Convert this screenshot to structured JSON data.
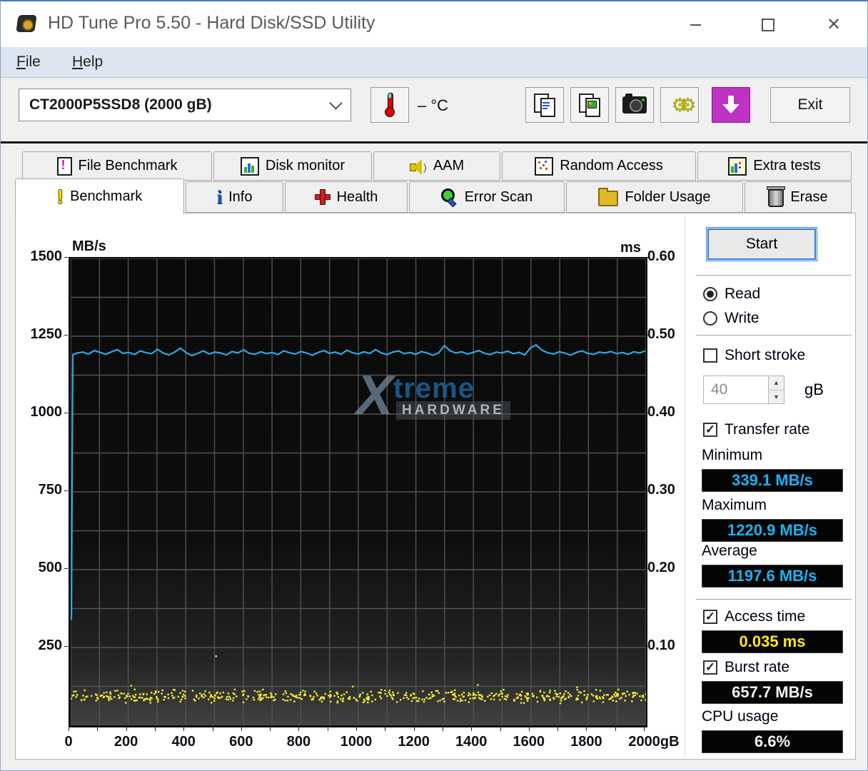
{
  "window": {
    "title": "HD Tune Pro 5.50 - Hard Disk/SSD Utility"
  },
  "menu": {
    "items": [
      {
        "accel": "F",
        "rest": "ile"
      },
      {
        "accel": "H",
        "rest": "elp"
      }
    ]
  },
  "toolbar": {
    "drive_select": "CT2000P5SSD8 (2000 gB)",
    "temperature": "– °C",
    "exit_label": "Exit",
    "icons": [
      "thermometer-icon",
      "copy-text-icon",
      "copy-image-icon",
      "camera-icon",
      "gears-icon",
      "save-arrow-icon"
    ]
  },
  "tabs": {
    "row1": [
      "File Benchmark",
      "Disk monitor",
      "AAM",
      "Random Access",
      "Extra tests"
    ],
    "row2": [
      "Benchmark",
      "Info",
      "Health",
      "Error Scan",
      "Folder Usage",
      "Erase"
    ],
    "active": "Benchmark"
  },
  "controls": {
    "start": "Start",
    "read": "Read",
    "write": "Write",
    "short_stroke": "Short stroke",
    "short_stroke_value": "40",
    "short_stroke_unit": "gB",
    "transfer_rate": "Transfer rate",
    "minimum": "Minimum",
    "maximum": "Maximum",
    "average": "Average",
    "access_time": "Access time",
    "burst_rate": "Burst rate",
    "cpu_usage": "CPU usage",
    "spin_up": "▲",
    "spin_down": "▼",
    "check_glyph": "✓",
    "values": {
      "minimum": "339.1 MB/s",
      "maximum": "1220.9 MB/s",
      "average": "1197.6 MB/s",
      "access_time": "0.035 ms",
      "burst_rate": "657.7 MB/s",
      "cpu_usage": "6.6%"
    }
  },
  "watermark": {
    "x": "X",
    "treme": "treme",
    "hardware": "HARDWARE"
  },
  "chart_data": {
    "type": "line",
    "title": "HD Tune benchmark transfer rate and access time",
    "x_axis": {
      "min": 0,
      "max": 2000,
      "grid_step": 100,
      "label_step": 200,
      "end_suffix": "gB"
    },
    "y_left": {
      "label": "MB/s",
      "min": 0,
      "max": 1500,
      "grid_step": 125,
      "label_step": 250
    },
    "y_right": {
      "label": "ms",
      "min": 0,
      "max": 0.6,
      "label_step": 0.1
    },
    "grid": true,
    "grid_color": "#525252",
    "series": [
      {
        "name": "transfer-rate",
        "unit": "MB/s",
        "color": "#2fa9dd",
        "style": "line",
        "points": [
          [
            0,
            339.1
          ],
          [
            5,
            1191
          ],
          [
            20,
            1196
          ],
          [
            40,
            1199
          ],
          [
            60,
            1193
          ],
          [
            80,
            1204
          ],
          [
            100,
            1198
          ],
          [
            120,
            1192
          ],
          [
            140,
            1200
          ],
          [
            160,
            1207
          ],
          [
            180,
            1195
          ],
          [
            200,
            1198
          ],
          [
            220,
            1191
          ],
          [
            240,
            1203
          ],
          [
            260,
            1197
          ],
          [
            280,
            1194
          ],
          [
            300,
            1208
          ],
          [
            320,
            1196
          ],
          [
            340,
            1190
          ],
          [
            360,
            1199
          ],
          [
            380,
            1212
          ],
          [
            400,
            1197
          ],
          [
            420,
            1188
          ],
          [
            440,
            1195
          ],
          [
            460,
            1203
          ],
          [
            480,
            1193
          ],
          [
            500,
            1199
          ],
          [
            520,
            1196
          ],
          [
            540,
            1190
          ],
          [
            560,
            1201
          ],
          [
            580,
            1196
          ],
          [
            600,
            1206
          ],
          [
            620,
            1195
          ],
          [
            640,
            1192
          ],
          [
            660,
            1200
          ],
          [
            680,
            1194
          ],
          [
            700,
            1198
          ],
          [
            720,
            1191
          ],
          [
            740,
            1203
          ],
          [
            760,
            1197
          ],
          [
            780,
            1193
          ],
          [
            800,
            1201
          ],
          [
            820,
            1196
          ],
          [
            840,
            1189
          ],
          [
            860,
            1198
          ],
          [
            880,
            1204
          ],
          [
            900,
            1195
          ],
          [
            920,
            1199
          ],
          [
            940,
            1192
          ],
          [
            960,
            1205
          ],
          [
            980,
            1197
          ],
          [
            1000,
            1193
          ],
          [
            1020,
            1200
          ],
          [
            1040,
            1195
          ],
          [
            1060,
            1207
          ],
          [
            1080,
            1196
          ],
          [
            1100,
            1191
          ],
          [
            1120,
            1199
          ],
          [
            1140,
            1203
          ],
          [
            1160,
            1194
          ],
          [
            1180,
            1198
          ],
          [
            1200,
            1192
          ],
          [
            1220,
            1201
          ],
          [
            1240,
            1196
          ],
          [
            1260,
            1189
          ],
          [
            1280,
            1197
          ],
          [
            1300,
            1220
          ],
          [
            1320,
            1203
          ],
          [
            1340,
            1196
          ],
          [
            1360,
            1200
          ],
          [
            1380,
            1193
          ],
          [
            1400,
            1198
          ],
          [
            1420,
            1204
          ],
          [
            1440,
            1195
          ],
          [
            1460,
            1191
          ],
          [
            1480,
            1199
          ],
          [
            1500,
            1196
          ],
          [
            1520,
            1202
          ],
          [
            1540,
            1194
          ],
          [
            1560,
            1198
          ],
          [
            1580,
            1190
          ],
          [
            1600,
            1213
          ],
          [
            1620,
            1222
          ],
          [
            1640,
            1205
          ],
          [
            1660,
            1197
          ],
          [
            1680,
            1193
          ],
          [
            1700,
            1200
          ],
          [
            1720,
            1196
          ],
          [
            1740,
            1189
          ],
          [
            1760,
            1198
          ],
          [
            1780,
            1203
          ],
          [
            1800,
            1195
          ],
          [
            1820,
            1192
          ],
          [
            1840,
            1199
          ],
          [
            1860,
            1196
          ],
          [
            1880,
            1201
          ],
          [
            1900,
            1194
          ],
          [
            1920,
            1198
          ],
          [
            1940,
            1192
          ],
          [
            1960,
            1200
          ],
          [
            1980,
            1196
          ],
          [
            2000,
            1203
          ]
        ]
      },
      {
        "name": "access-time",
        "unit": "ms",
        "color": "#f2ee35",
        "style": "scatter",
        "band": {
          "count": 560,
          "x_min": 0,
          "x_max": 2000,
          "y_min_ms": 0.028,
          "y_max_ms": 0.047,
          "seed": 97531
        },
        "outliers": [
          [
            210,
            0.051
          ],
          [
            505,
            0.089
          ],
          [
            980,
            0.05
          ],
          [
            1415,
            0.052
          ],
          [
            1760,
            0.049
          ]
        ]
      }
    ],
    "stats": {
      "minimum_mbps": 339.1,
      "maximum_mbps": 1220.9,
      "average_mbps": 1197.6,
      "access_time_ms": 0.035,
      "burst_rate_mbps": 657.7,
      "cpu_usage_pct": 6.6
    },
    "legend_position": "none"
  },
  "colors": {
    "line_blue": "#2fa9dd",
    "scatter_yellow": "#f2ee35",
    "value_cyan": "#1ab2f1",
    "value_yellow": "#ffe818",
    "value_white": "#f2f2f2",
    "save_purple": "#c032c4",
    "start_border": "#2e7cd6"
  }
}
